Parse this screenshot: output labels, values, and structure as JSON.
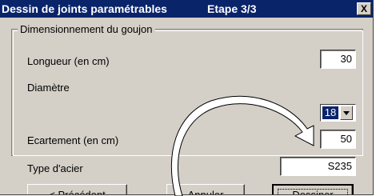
{
  "window": {
    "title": "Dessin de joints paramétrables",
    "step": "Etape 3/3",
    "close_label": "X"
  },
  "group": {
    "legend": "Dimensionnement du goujon"
  },
  "fields": {
    "longueur": {
      "label": "Longueur (en cm)",
      "value": "30"
    },
    "diametre": {
      "label": "Diamètre",
      "value": "18"
    },
    "ecartement": {
      "label": "Ecartement (en cm)",
      "value": "50"
    },
    "acier": {
      "label": "Type d'acier",
      "value": "S235"
    }
  },
  "buttons": {
    "previous": "< Précédent",
    "cancel": "Annuler",
    "draw": "Dessiner"
  },
  "colors": {
    "titlebar": "#0a246a",
    "face": "#d4d0c8",
    "selection": "#0a246a"
  }
}
